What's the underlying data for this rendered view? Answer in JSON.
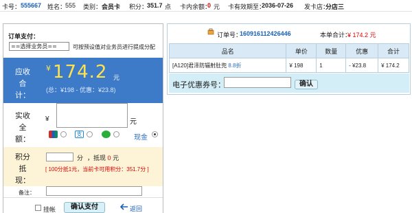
{
  "card_info": {
    "card_no_label": "卡号：",
    "card_no": "555667",
    "name_label": "姓名：",
    "name": "555",
    "category_label": "类别：",
    "category": "会员卡",
    "points_label": "积分：",
    "points": "351.7",
    "points_unit": "点",
    "balance_label": "卡内余额：",
    "balance": "0",
    "balance_unit": "元",
    "expiry_label": "卡有效期至：",
    "expiry": "2036-07-26",
    "issuer_label": "发卡店：",
    "issuer": "分店三"
  },
  "payment": {
    "title": "订单支付：",
    "salesperson_select": "==选择业务员==",
    "salesperson_hint": "可按预设值对业务员进行提成分配",
    "due_label": "应收合计：",
    "currency": "¥",
    "due_amount": "174.2",
    "due_unit": "元",
    "due_detail": "(总：¥198 - 优惠：¥23.8)",
    "received_label": "实收全额：",
    "received_currency": "¥",
    "received_unit": "元",
    "cash_label": "现金",
    "points_label": "积分抵现：",
    "points_unit": "分",
    "offset_label": "，抵现",
    "offset_amount": "0",
    "offset_unit": "元",
    "points_rule": "[ 100分抵1元，当前卡可用积分：351.7分 ]",
    "remark_label": "备注：",
    "hang_label": "挂帐",
    "confirm_label": "确认支付",
    "back_label": "返回"
  },
  "order": {
    "order_no_label": "订单号：",
    "order_no": "160916112426446",
    "order_total_label": "本单合计：",
    "order_total": "¥ 174.2 元",
    "columns": [
      "品名",
      "单价",
      "数量",
      "优惠",
      "合计"
    ],
    "items": [
      {
        "name": "[A120]君泽防辐射肚兜",
        "discount_rate": "8.8折",
        "price": "¥ 198",
        "qty": "1",
        "discount": "- ¥23.8",
        "total": "¥ 174.2"
      }
    ],
    "coupon_label": "电子优惠券号：",
    "coupon_confirm": "确认"
  },
  "colors": {
    "due_panel": "#3d7bc8",
    "due_amount": "#ffe34d",
    "points_panel": "#fdf3d6",
    "accent_red": "#e00000",
    "link_blue": "#1a5fb4"
  }
}
